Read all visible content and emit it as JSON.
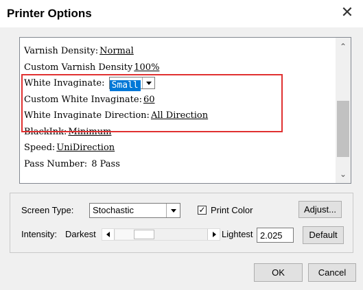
{
  "window": {
    "title": "Printer Options",
    "close_glyph": "✕"
  },
  "options_list": {
    "items": [
      {
        "label": "Varnish Density:",
        "value": "Normal"
      },
      {
        "label": "Custom Varnish Density",
        "value": "100%"
      },
      {
        "label": "White Invaginate:",
        "value": "Small",
        "control": "dropdown"
      },
      {
        "label": "Custom White Invaginate:",
        "value": "60"
      },
      {
        "label": "White Invaginate Direction:",
        "value": "All Direction"
      },
      {
        "label": "BlackInk:",
        "value": "Minimum"
      },
      {
        "label": "Speed:",
        "value": "UniDirection"
      },
      {
        "label": "Pass Number:",
        "value": "8 Pass"
      }
    ],
    "scroll_up_glyph": "⌃",
    "scroll_down_glyph": "⌄",
    "highlight_color": "#e03030"
  },
  "screen_settings": {
    "screen_type_label": "Screen Type:",
    "screen_type_value": "Stochastic",
    "print_color_label": "Print Color",
    "print_color_checked": true,
    "print_color_check_glyph": "✓",
    "adjust_label": "Adjust...",
    "intensity_label": "Intensity:",
    "darkest_label": "Darkest",
    "lightest_label": "Lightest",
    "intensity_value": "2.025",
    "default_label": "Default"
  },
  "footer": {
    "ok_label": "OK",
    "cancel_label": "Cancel"
  },
  "colors": {
    "selection": "#0078d7",
    "dialog_bg": "#f0f0f0"
  }
}
